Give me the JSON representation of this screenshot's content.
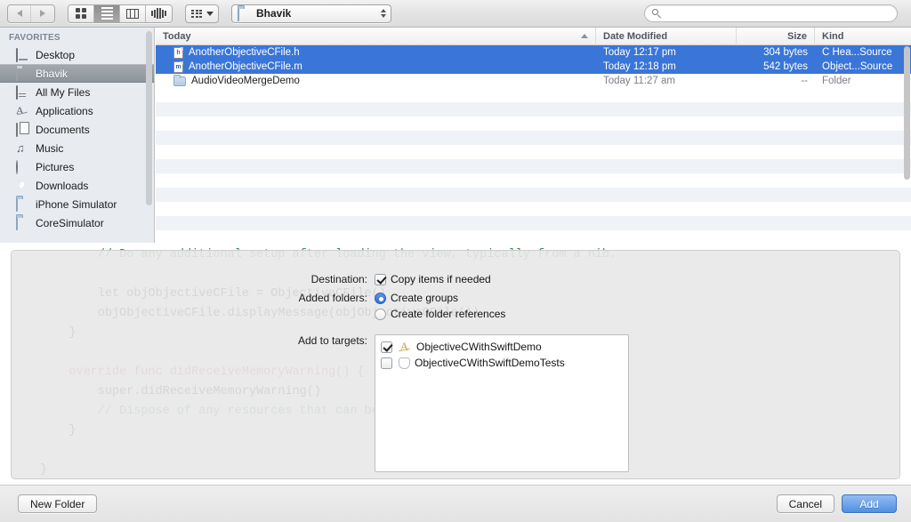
{
  "toolbar": {
    "back_label": "back-arrow",
    "forward_label": "forward-arrow",
    "view_icon_label": "icon-view",
    "view_list_label": "list-view",
    "view_column_label": "column-view",
    "view_coverflow_label": "coverflow-view",
    "arrange_label": "arrange-by",
    "path_label": "Bhavik",
    "search_placeholder": "",
    "search_value": ""
  },
  "sidebar": {
    "header": "FAVORITES",
    "items": [
      {
        "label": "Desktop",
        "icon": "screen-icon",
        "selected": false
      },
      {
        "label": "Bhavik",
        "icon": "folder-icon",
        "selected": true
      },
      {
        "label": "All My Files",
        "icon": "disk-icon",
        "selected": false
      },
      {
        "label": "Applications",
        "icon": "app-icon",
        "selected": false
      },
      {
        "label": "Documents",
        "icon": "document-icon",
        "selected": false
      },
      {
        "label": "Music",
        "icon": "music-icon",
        "selected": false
      },
      {
        "label": "Pictures",
        "icon": "camera-icon",
        "selected": false
      },
      {
        "label": "Downloads",
        "icon": "download-icon",
        "selected": false
      },
      {
        "label": "iPhone Simulator",
        "icon": "folder-icon",
        "selected": false
      },
      {
        "label": "CoreSimulator",
        "icon": "folder-icon",
        "selected": false
      }
    ]
  },
  "filelist": {
    "columns": [
      "Today",
      "Date Modified",
      "Size",
      "Kind"
    ],
    "sort_column": "Today",
    "sort_direction": "ascending",
    "rows": [
      {
        "name": "AnotherObjectiveCFile.h",
        "date": "Today 12:17 pm",
        "size": "304 bytes",
        "kind": "C Hea...Source",
        "icon": "c-header-file-icon",
        "selected": true
      },
      {
        "name": "AnotherObjectiveCFile.m",
        "date": "Today 12:18 pm",
        "size": "542 bytes",
        "kind": "Object...Source",
        "icon": "objc-source-file-icon",
        "selected": true
      },
      {
        "name": "AudioVideoMergeDemo",
        "date": "Today 11:27 am",
        "size": "--",
        "kind": "Folder",
        "icon": "folder-icon",
        "selected": false
      }
    ]
  },
  "code_background": {
    "lines": [
      "        // Do any additional setup after loading the view, typically from a nib.",
      "",
      "        let objObjectiveCFile = ObjectiveCFile()",
      "        objObjectiveCFile.displayMessage(objObjectiveCFile())",
      "    }",
      "",
      "    override func didReceiveMemoryWarning() {",
      "        super.didReceiveMemoryWarning()",
      "        // Dispose of any resources that can be recreated.",
      "    }",
      "",
      "}"
    ]
  },
  "options": {
    "destination_label": "Destination:",
    "copy_items_label": "Copy items if needed",
    "copy_items_checked": true,
    "added_folders_label": "Added folders:",
    "create_groups_label": "Create groups",
    "create_folder_refs_label": "Create folder references",
    "added_folders_selected": "Create groups",
    "add_to_targets_label": "Add to targets:",
    "targets": [
      {
        "label": "ObjectiveCWithSwiftDemo",
        "checked": true,
        "icon": "app-target-icon"
      },
      {
        "label": "ObjectiveCWithSwiftDemoTests",
        "checked": false,
        "icon": "test-target-icon"
      }
    ]
  },
  "footer": {
    "new_folder_label": "New Folder",
    "cancel_label": "Cancel",
    "add_label": "Add"
  },
  "colors": {
    "selection_blue": "#3a76d8",
    "default_button_blue": "#4f8fe0",
    "sidebar_bg": "#e8ecf1",
    "stripe": "#eff3f8"
  }
}
